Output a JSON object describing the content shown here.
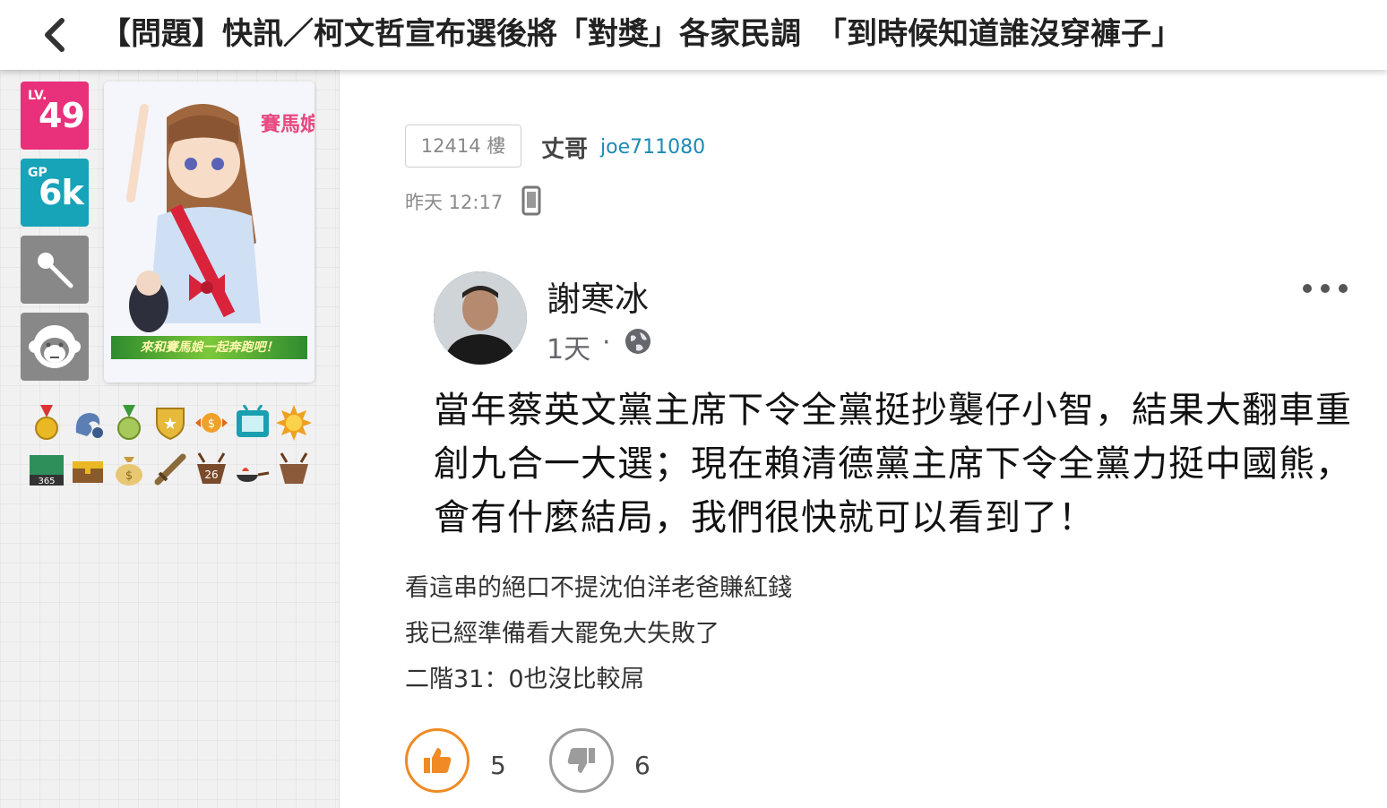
{
  "header": {
    "title": "【問題】快訊／柯文哲宣布選後將「對獎」各家民調　「到時候知道誰沒穿褲子」"
  },
  "sidebar": {
    "level_label": "LV.",
    "level_value": "49",
    "gp_label": "GP",
    "gp_value": "6k",
    "card_banner": "來和賽馬娘一起奔跑吧！"
  },
  "post": {
    "floor": "12414 樓",
    "author_name": "丈哥",
    "author_id": "joe711080",
    "time": "昨天 12:17",
    "fb": {
      "name": "謝寒冰",
      "time": "1天",
      "dot": "·",
      "text": "當年蔡英文黨主席下令全黨挺抄襲仔小智，結果大翻車重創九合一大選；現在賴清德黨主席下令全黨力挺中國熊，會有什麼結局，我們很快就可以看到了！"
    },
    "replies": [
      "看這串的絕口不提沈伯洋老爸賺紅錢",
      "我已經準備看大罷免大失敗了",
      "二階31：0也沒比較屌"
    ],
    "upvotes": "5",
    "downvotes": "6"
  },
  "colors": {
    "level_tile": "#e9307a",
    "gp_tile": "#17a3b8",
    "upvote": "#f08a24",
    "downvote": "#9c9c9c",
    "author_id": "#1b8bb5"
  },
  "icons": [
    "back-chevron-icon",
    "microphone-icon",
    "monkey-face-icon",
    "mobile-device-icon",
    "globe-icon",
    "more-dots-icon",
    "thumbs-up-icon",
    "thumbs-down-icon"
  ]
}
